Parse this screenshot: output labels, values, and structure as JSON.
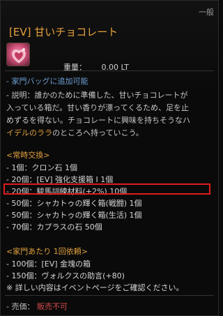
{
  "header": {
    "grade": "一般",
    "title": "[EV] 甘いチョコレート",
    "weight_label": "重量：",
    "weight_value": "0.00 LT"
  },
  "icon": {
    "name": "heart-chocolate-box-icon",
    "accent": "#d2527a"
  },
  "notice": "- 家門バッグに追加可能",
  "description": {
    "line1": "- 説明：誰かのために準備した、甘いチョコレートが",
    "line2": "入っている箱だ。甘い香りが漂ってくるため、足を止",
    "line3": "めずるを得ない。チョコレートに興味を持ちそうなハ",
    "line4_highlight": "イデルのララ",
    "line4_rest": "のところへ持っていこう。"
  },
  "exchange": {
    "heading": "<常時交換>",
    "items": [
      "- 1個：クロン石 1個",
      "- 20個：[EV] 強化支援箱 I 1個",
      "- 20個：駿馬訓練材料(+2%) 10個",
      "- 50個：シャカトゥの輝く箱(戦闘) 1個",
      "- 50個：シャカトゥの輝く箱(生活) 1個",
      "- 70個：カプラスの石 50個"
    ]
  },
  "request": {
    "heading": "<家門あたり 1回依頼>",
    "items": [
      "- 100個：[EV] 金塊の箱",
      "- 150個：ヴォルクスの助言(+80)"
    ],
    "note": "※ 詳しい内容はイベントページをご確認ください。"
  },
  "footer": {
    "sell_label": "- 売価：",
    "sell_value": "販売不可"
  },
  "colors": {
    "title": "#e7a13c",
    "blue": "#6b9ed1",
    "orange": "#e1a03f",
    "red": "#d44b4b",
    "highlight_box": "#e01c1c"
  }
}
